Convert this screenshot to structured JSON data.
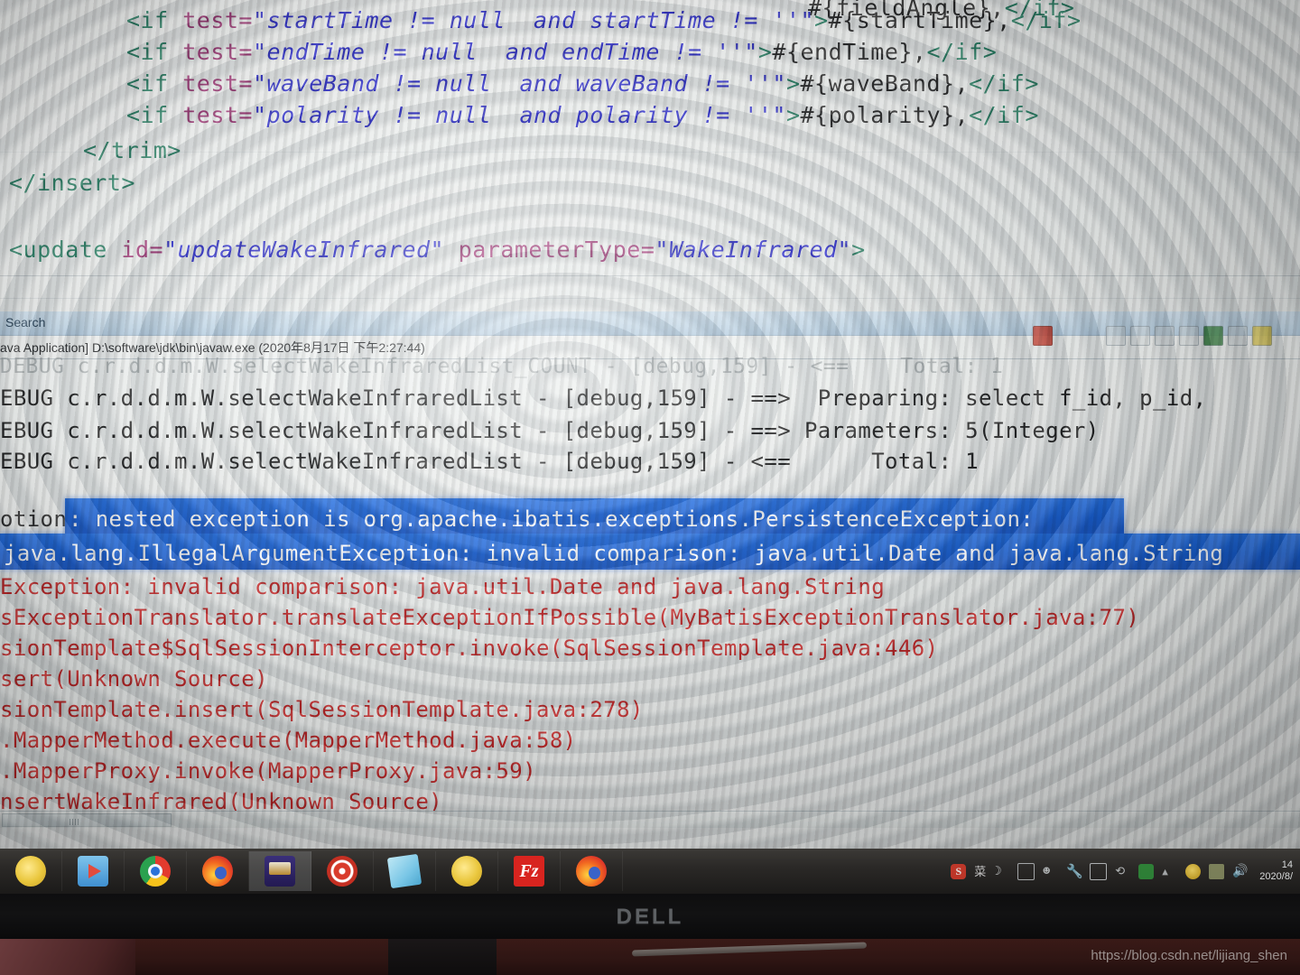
{
  "editor": {
    "lines": [
      {
        "indent": 140,
        "text": "#{fieldAngle},</if>",
        "partial": true
      },
      {
        "indent": 140,
        "text": "<if test=\"startTime != null  and startTime != ''\">#{startTime},</if>"
      },
      {
        "indent": 140,
        "text": "<if test=\"endTime != null  and endTime != ''\">#{endTime},</if>"
      },
      {
        "indent": 140,
        "text": "<if test=\"waveBand != null  and waveBand != ''\">#{waveBand},</if>"
      },
      {
        "indent": 140,
        "text": "<if test=\"polarity != null  and polarity != ''\">#{polarity},</if>"
      },
      {
        "indent": 95,
        "text": "</trim>"
      },
      {
        "indent": 10,
        "text": "</insert>"
      },
      {
        "indent": 10,
        "text": "<update id=\"updateWakeInfrared\" parameterType=\"WakeInfrared\">"
      }
    ]
  },
  "console": {
    "tab_label": "Search",
    "launch_title": "ava Application] D:\\software\\jdk\\bin\\javaw.exe (2020年8月17日 下午2:27:44)",
    "toolbar_icons": [
      "terminate-icon",
      "remove-launch-icon",
      "remove-all-icon",
      "lock-icon",
      "pin-console-icon",
      "display-selected-console-icon",
      "open-console-icon",
      "scroll-lock-icon",
      "word-wrap-icon",
      "new-console-view-icon"
    ],
    "log_lines": [
      {
        "text": "DEBUG c.r.d.d.m.W.selectWakeInfraredList_COUNT - [debug,159] - <==    Total: 1",
        "style": "ghost"
      },
      {
        "text": "EBUG c.r.d.d.m.W.selectWakeInfraredList - [debug,159] - ==>  Preparing: select f_id, p_id,",
        "style": "normal"
      },
      {
        "text": "EBUG c.r.d.d.m.W.selectWakeInfraredList - [debug,159] - ==> Parameters: 5(Integer)",
        "style": "normal"
      },
      {
        "text": "EBUG c.r.d.d.m.W.selectWakeInfraredList - [debug,159] - <==      Total: 1",
        "style": "normal"
      }
    ],
    "selected_lines": [
      {
        "prefix": "otion",
        "text": ": nested exception is org.apache.ibatis.exceptions.PersistenceException:"
      },
      {
        "prefix": "",
        "text": "java.lang.IllegalArgumentException: invalid comparison: java.util.Date and java.lang.String"
      }
    ],
    "error_lines": [
      "Exception: invalid comparison: java.util.Date and java.lang.String",
      "sExceptionTranslator.translateExceptionIfPossible(MyBatisExceptionTranslator.java:77)",
      "sionTemplate$SqlSessionInterceptor.invoke(SqlSessionTemplate.java:446)",
      "sert(Unknown Source)",
      "sionTemplate.insert(SqlSessionTemplate.java:278)",
      ".MapperMethod.execute(MapperMethod.java:58)",
      ".MapperProxy.invoke(MapperProxy.java:59)",
      "nsertWakeInfrared(Unknown Source)"
    ]
  },
  "taskbar": {
    "items": [
      {
        "name": "taskbar-item-app1",
        "icon": "coin-icon",
        "active": false
      },
      {
        "name": "taskbar-item-media-player",
        "icon": "media-player-icon",
        "active": false
      },
      {
        "name": "taskbar-item-chrome",
        "icon": "chrome-icon",
        "active": false
      },
      {
        "name": "taskbar-item-firefox",
        "icon": "firefox-icon",
        "active": false
      },
      {
        "name": "taskbar-item-game",
        "icon": "game-icon",
        "active": true
      },
      {
        "name": "taskbar-item-spiral-app",
        "icon": "spiral-icon",
        "active": false
      },
      {
        "name": "taskbar-item-notes",
        "icon": "notes-icon",
        "active": false
      },
      {
        "name": "taskbar-item-coin-app",
        "icon": "coin-icon",
        "active": false
      },
      {
        "name": "taskbar-item-filezilla",
        "icon": "filezilla-icon",
        "label": "Fz",
        "active": false
      },
      {
        "name": "taskbar-item-firefox-2",
        "icon": "firefox-icon",
        "active": false
      }
    ],
    "tray": [
      {
        "name": "tray-sogou-input-icon",
        "label": "S"
      },
      {
        "name": "tray-ime-mode-icon",
        "label": "菜"
      },
      {
        "name": "tray-moon-icon",
        "label": "☽"
      },
      {
        "name": "tray-keyboard-icon",
        "label": ""
      },
      {
        "name": "tray-user-icon",
        "label": "☻"
      },
      {
        "name": "tray-wrench-icon",
        "label": "🔧"
      },
      {
        "name": "tray-screenshot-icon",
        "label": ""
      },
      {
        "name": "tray-sync-icon",
        "label": "⟲"
      },
      {
        "name": "tray-green-app-icon",
        "label": ""
      },
      {
        "name": "tray-show-hidden-icons-icon",
        "label": "▲"
      },
      {
        "name": "tray-antivirus-icon",
        "label": ""
      },
      {
        "name": "tray-network-icon",
        "label": ""
      },
      {
        "name": "tray-volume-icon",
        "label": "🔊"
      }
    ],
    "clock_time": "14",
    "clock_date": "2020/8/"
  },
  "monitor": {
    "brand": "DELL"
  },
  "watermark": "https://blog.csdn.net/lijiang_shen"
}
